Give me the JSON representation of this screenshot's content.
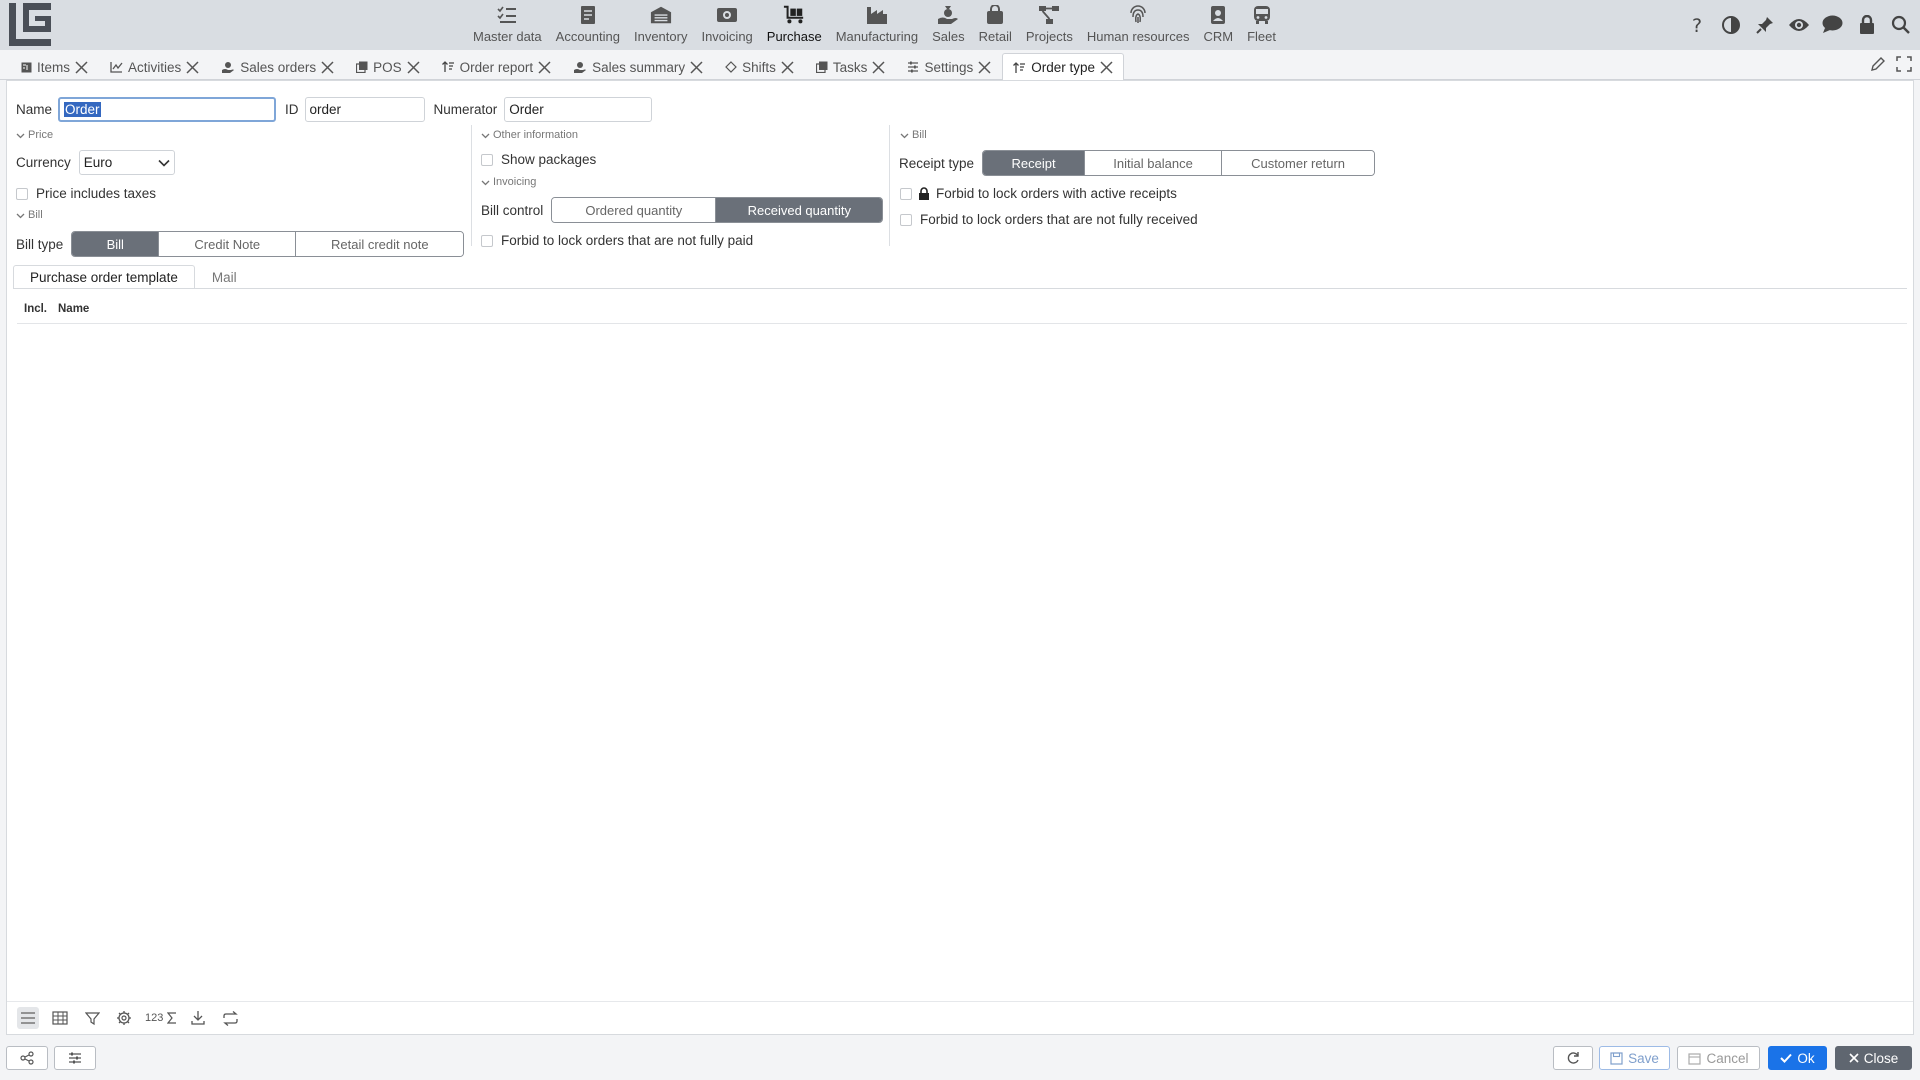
{
  "nav": {
    "modules": [
      {
        "label": "Master data",
        "icon": "checklist-icon",
        "active": false
      },
      {
        "label": "Accounting",
        "icon": "ledger-icon",
        "active": false
      },
      {
        "label": "Inventory",
        "icon": "warehouse-icon",
        "active": false
      },
      {
        "label": "Invoicing",
        "icon": "invoice-icon",
        "active": false
      },
      {
        "label": "Purchase",
        "icon": "cart-icon",
        "active": true
      },
      {
        "label": "Manufacturing",
        "icon": "factory-icon",
        "active": false
      },
      {
        "label": "Sales",
        "icon": "hand-money-icon",
        "active": false
      },
      {
        "label": "Retail",
        "icon": "shopping-bag-icon",
        "active": false
      },
      {
        "label": "Projects",
        "icon": "project-tree-icon",
        "active": false
      },
      {
        "label": "Human resources",
        "icon": "fingerprint-icon",
        "active": false
      },
      {
        "label": "CRM",
        "icon": "contact-card-icon",
        "active": false
      },
      {
        "label": "Fleet",
        "icon": "bus-icon",
        "active": false
      }
    ],
    "right_icons": [
      "help-icon",
      "contrast-icon",
      "pin-icon",
      "eye-icon",
      "chat-icon",
      "lock-icon",
      "search-icon"
    ]
  },
  "tabs": [
    {
      "label": "Items",
      "icon": "items-icon",
      "active": false
    },
    {
      "label": "Activities",
      "icon": "chart-line-icon",
      "active": false
    },
    {
      "label": "Sales orders",
      "icon": "hand-money-icon",
      "active": false
    },
    {
      "label": "POS",
      "icon": "copy-icon",
      "active": false
    },
    {
      "label": "Order report",
      "icon": "sort-icon",
      "active": false
    },
    {
      "label": "Sales summary",
      "icon": "hand-money-icon",
      "active": false
    },
    {
      "label": "Shifts",
      "icon": "diamond-icon",
      "active": false
    },
    {
      "label": "Tasks",
      "icon": "copy-icon",
      "active": false
    },
    {
      "label": "Settings",
      "icon": "sliders-icon",
      "active": false
    },
    {
      "label": "Order type",
      "icon": "sort-icon",
      "active": true
    }
  ],
  "form": {
    "name_label": "Name",
    "name_value": "Order",
    "id_label": "ID",
    "id_value": "order",
    "numerator_label": "Numerator",
    "numerator_value": "Order",
    "price_section": "Price",
    "currency_label": "Currency",
    "currency_value": "Euro",
    "price_includes_taxes": "Price includes taxes",
    "bill_section_left": "Bill",
    "bill_type_label": "Bill type",
    "bill_type_options": [
      "Bill",
      "Credit Note",
      "Retail credit note"
    ],
    "bill_type_selected": 0,
    "other_info_section": "Other information",
    "show_packages": "Show packages",
    "invoicing_section": "Invoicing",
    "bill_control_label": "Bill control",
    "bill_control_options": [
      "Ordered quantity",
      "Received quantity"
    ],
    "bill_control_selected": 1,
    "forbid_not_paid": "Forbid to lock orders that are not fully paid",
    "bill_section_right": "Bill",
    "receipt_type_label": "Receipt type",
    "receipt_type_options": [
      "Receipt",
      "Initial balance",
      "Customer return"
    ],
    "receipt_type_selected": 0,
    "forbid_active_receipts": "Forbid to lock orders with active receipts",
    "forbid_not_received": "Forbid to lock orders that are not fully received"
  },
  "subtabs": [
    {
      "label": "Purchase order template",
      "active": true
    },
    {
      "label": "Mail",
      "active": false
    }
  ],
  "table": {
    "columns": [
      "Incl.",
      "Name"
    ],
    "rows": []
  },
  "grid_toolbar": [
    "list-view-icon",
    "table-view-icon",
    "filter-icon",
    "gear-icon",
    "sum-icon",
    "download-icon",
    "refresh-icon"
  ],
  "grid_sum_label": "123",
  "bottom": {
    "save": "Save",
    "cancel": "Cancel",
    "ok": "Ok",
    "close": "Close"
  },
  "colors": {
    "accent": "#1a73e8",
    "segment_active": "#6a7079",
    "topbar": "#d9dde2"
  }
}
